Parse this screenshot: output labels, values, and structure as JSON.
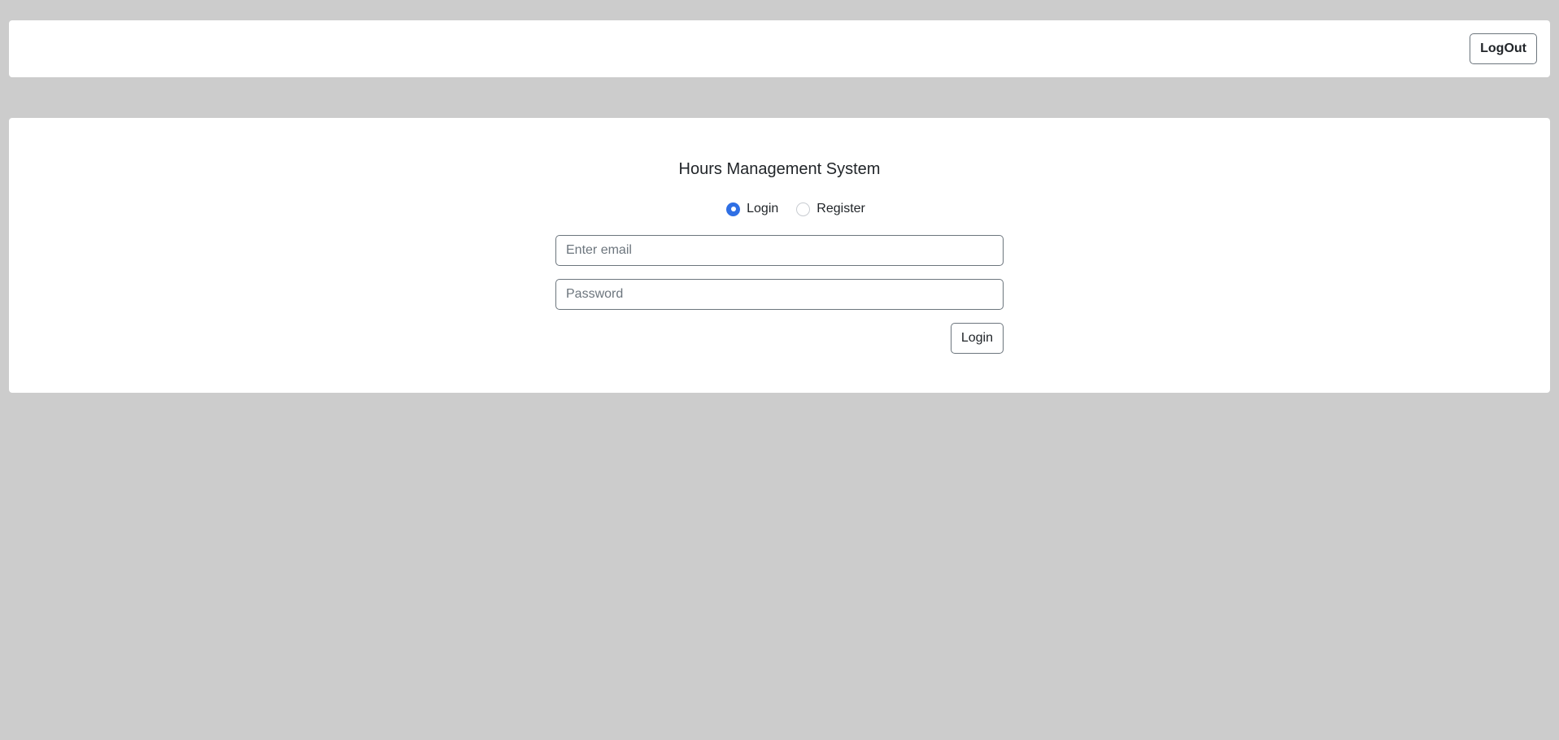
{
  "header": {
    "logout_label": "LogOut"
  },
  "main": {
    "title": "Hours Management System",
    "mode": {
      "options": [
        {
          "label": "Login",
          "checked": true
        },
        {
          "label": "Register",
          "checked": false
        }
      ]
    },
    "email": {
      "value": "",
      "placeholder": "Enter email"
    },
    "password": {
      "value": "",
      "placeholder": "Password"
    },
    "submit_label": "Login"
  },
  "colors": {
    "page_background": "#cccccc",
    "card_background": "#ffffff",
    "accent": "#2f6fe4",
    "border": "#6c757d",
    "text": "#212529"
  }
}
